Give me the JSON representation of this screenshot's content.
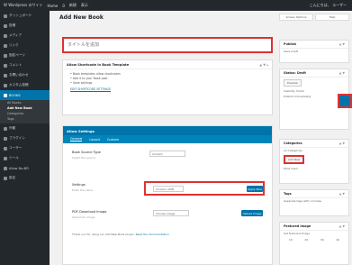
{
  "topbar": {
    "site": "W  Wordpress のサイト",
    "items": [
      "Home",
      "0",
      "新規",
      "表示"
    ],
    "howdy": "こんにちは、 ユーザー"
  },
  "sidebar": {
    "items": [
      {
        "label": "ダッシュボード"
      },
      {
        "label": "投稿"
      },
      {
        "label": "メディア"
      },
      {
        "label": "リンク"
      },
      {
        "label": "固定ページ"
      },
      {
        "label": "コメント"
      },
      {
        "label": "お問い合わせ"
      },
      {
        "label": "カスタム投稿"
      },
      {
        "label": "BOOKS",
        "active": true
      }
    ],
    "submenu": [
      {
        "label": "All Books"
      },
      {
        "label": "Add New Book",
        "current": true
      },
      {
        "label": "Categories"
      },
      {
        "label": "Tags"
      }
    ],
    "items_after": [
      {
        "label": "外観"
      },
      {
        "label": "プラグイン"
      },
      {
        "label": "ユーザー"
      },
      {
        "label": "ツール"
      },
      {
        "label": "Allow No-BR"
      },
      {
        "label": "設定"
      }
    ]
  },
  "main": {
    "page_title": "Add New Book",
    "title_placeholder": "タイトルを追加",
    "notice": {
      "header": "Allow Shortcode in Book Template",
      "lines": [
        "Book templates allow shortcodes",
        "Add it to your Book post",
        "Save settings"
      ],
      "link": "EDIT SHORTCODE SETTINGS"
    },
    "settings": {
      "title": "Allow Settings",
      "tabs": [
        "General",
        "Layout",
        "Custom"
      ],
      "rows": [
        {
          "label": "Book Source Type",
          "desc": "Select the source",
          "value": "Amazon"
        },
        {
          "label": "Settings",
          "desc": "Enter the value",
          "value": "Amazon ASIN",
          "button": "Apply Now"
        },
        {
          "label": "PDF Download Image",
          "desc": "Upload an image",
          "value": "Choose image",
          "button": "Upload Image"
        }
      ],
      "note": "Thank you for using our Add New Book plugin.",
      "note_link": "Read the documentation"
    }
  },
  "right": {
    "screen_tabs": [
      "Screen Options",
      "Help"
    ],
    "publish": {
      "header": "Publish",
      "lines": [
        "Save Draft",
        "Status: Draft",
        "Visibility: Public",
        "Publish immediately"
      ],
      "button": "Preview"
    },
    "categories": {
      "header": "Categories",
      "lines": [
        "All Categories",
        "Most Used"
      ],
      "button": "Add New"
    },
    "tags": {
      "header": "Tags",
      "lines": [
        "Separate tags with commas"
      ]
    },
    "extra": {
      "header": "Featured Image",
      "lines": [
        "Set featured image"
      ],
      "cells": [
        "10",
        "20",
        "30",
        "40"
      ]
    }
  }
}
